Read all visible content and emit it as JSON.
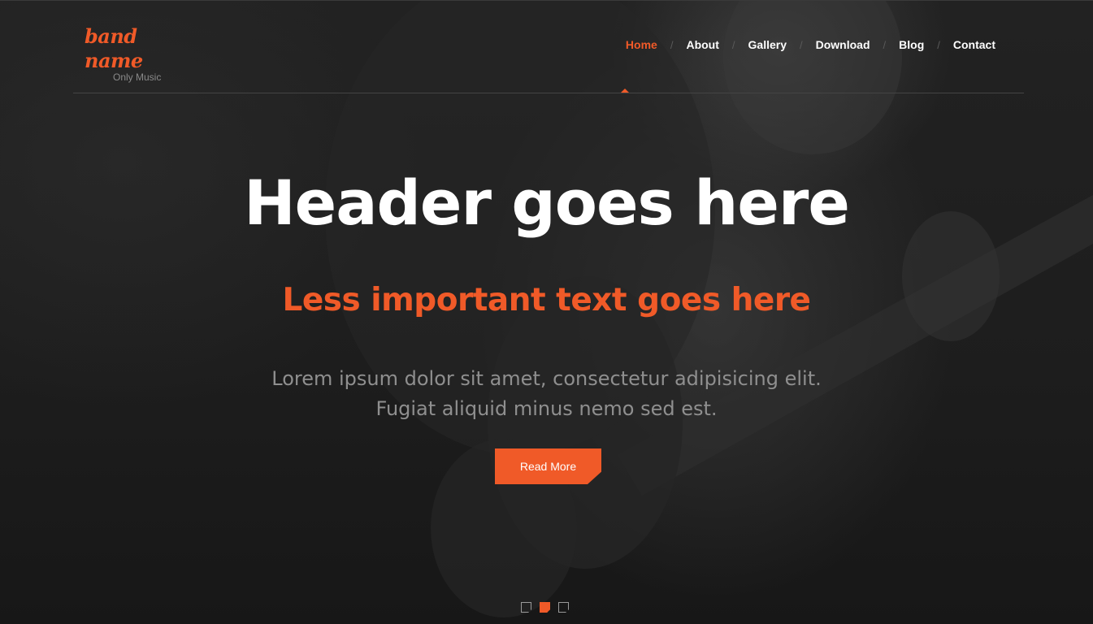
{
  "brand": {
    "name": "band name",
    "tagline": "Only Music",
    "accent_color": "#f05a28"
  },
  "nav": {
    "items": [
      {
        "label": "Home",
        "active": true
      },
      {
        "label": "About",
        "active": false
      },
      {
        "label": "Gallery",
        "active": false
      },
      {
        "label": "Download",
        "active": false
      },
      {
        "label": "Blog",
        "active": false
      },
      {
        "label": "Contact",
        "active": false
      }
    ],
    "separator": "/"
  },
  "hero": {
    "headline": "Header goes here",
    "subheadline": "Less important text goes here",
    "body_line1": "Lorem ipsum dolor sit amet, consectetur adipisicing elit.",
    "body_line2": "Fugiat aliquid minus nemo sed est.",
    "cta_label": "Read More",
    "background": "dark photo of a guitarist playing an electric guitar"
  },
  "slider": {
    "slide_count": 3,
    "active_index": 1
  }
}
